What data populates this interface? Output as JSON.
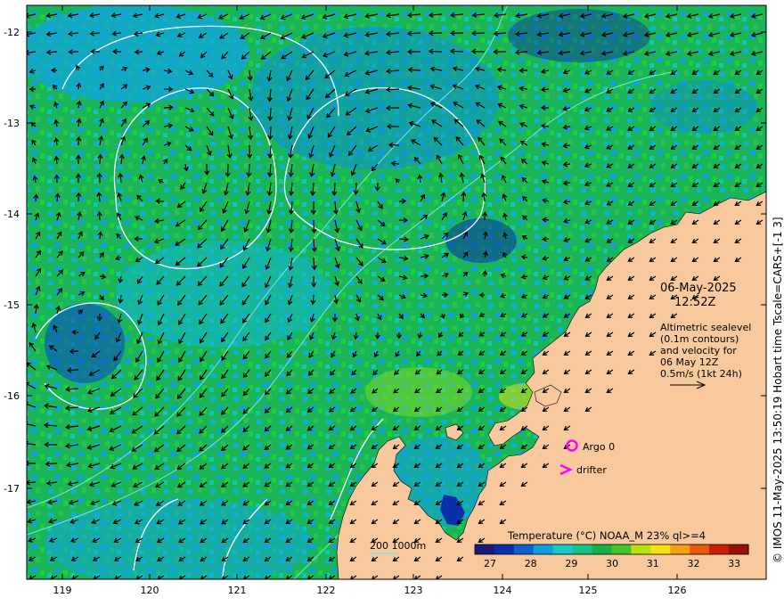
{
  "map": {
    "date": "06-May-2025",
    "time": "12:52Z",
    "info_lines": [
      "Altimetric sealevel",
      "(0.1m contours)",
      "and velocity for",
      "06 May 12Z",
      "0.5m/s (1kt 24h)"
    ],
    "legend_markers": {
      "argo": "Argo 0",
      "drifter": "drifter"
    },
    "depth_legend": "200  1000m",
    "colorbar": {
      "title": "Temperature (°C) NOAA_M 23% ql>=4",
      "ticks": [
        "27",
        "28",
        "29",
        "30",
        "31",
        "32",
        "33"
      ],
      "colors": [
        "#1a1a7a",
        "#0a2fa8",
        "#0d5fd0",
        "#0aa0e0",
        "#18c9c8",
        "#19c18a",
        "#16b048",
        "#48c22a",
        "#b8e20f",
        "#f5e214",
        "#f5a011",
        "#ea5a0c",
        "#c81e0a",
        "#981008"
      ]
    },
    "x_ticks": [
      "119",
      "120",
      "121",
      "122",
      "123",
      "124",
      "125",
      "126"
    ],
    "y_ticks": [
      "-12",
      "-13",
      "-14",
      "-15",
      "-16",
      "-17"
    ],
    "copyright": "© IMOS 11-May-2025 13:50:19 Hobart time Tscale=CARS+[-1 3]",
    "colors": {
      "land": "#f8c99c",
      "ocean_base": "#1fa85a",
      "contour": "#ffffff",
      "bathymetry": "#7fe6e6",
      "marker": "#ff00ff",
      "arrow": "#000000"
    }
  }
}
